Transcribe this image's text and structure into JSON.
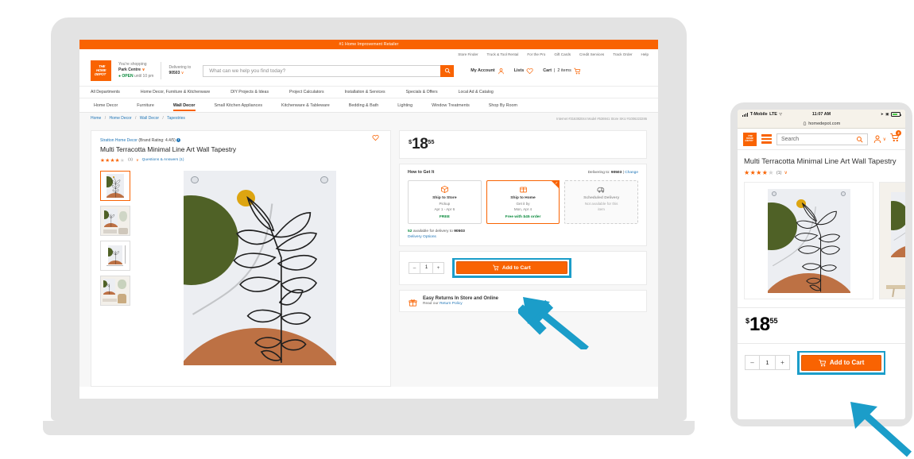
{
  "desktop": {
    "promo_banner": "#1 Home Improvement Retailer",
    "utility_links": [
      "Store Finder",
      "Truck & Tool Rental",
      "For the Pro",
      "Gift Cards",
      "Credit Services",
      "Track Order",
      "Help"
    ],
    "logo_text_1": "THE",
    "logo_text_2": "HOME",
    "logo_text_3": "DEPOT",
    "store": {
      "label": "You're shopping",
      "name": "Park Centre",
      "caret": "∨",
      "status": "OPEN",
      "status_dot": "●",
      "hours": "until 10 pm"
    },
    "delivery": {
      "label": "Delivering to",
      "zip": "90503",
      "caret": "∨"
    },
    "search": {
      "placeholder": "What can we help you find today?",
      "value": ""
    },
    "account": {
      "my_account": "My Account",
      "lists": "Lists",
      "cart_label": "Cart",
      "cart_divider": "|",
      "cart_items": "2 items"
    },
    "dept_nav": [
      "All Departments",
      "Home Decor, Furniture & Kitchenware",
      "DIY Projects & Ideas",
      "Project Calculators",
      "Installation & Services",
      "Specials & Offers",
      "Local Ad & Catalog"
    ],
    "cat_nav": [
      {
        "label": "Home Decor",
        "active": false
      },
      {
        "label": "Furniture",
        "active": false
      },
      {
        "label": "Wall Decor",
        "active": true
      },
      {
        "label": "Small Kitchen Appliances",
        "active": false
      },
      {
        "label": "Kitchenware & Tableware",
        "active": false
      },
      {
        "label": "Bedding & Bath",
        "active": false
      },
      {
        "label": "Lighting",
        "active": false
      },
      {
        "label": "Window Treatments",
        "active": false
      },
      {
        "label": "Shop By Room",
        "active": false
      }
    ],
    "breadcrumb": [
      "Home",
      "Home Decor",
      "Wall Decor",
      "Tapestries"
    ],
    "breadcrumb_sep": "/",
    "ids": "Internet #316382044   Model #536941   Store SKU #1006223286",
    "product": {
      "brand": "Stratton Home Decor",
      "brand_rating": "(Brand Rating: 4.4/5)",
      "info_glyph": "i",
      "title": "Multi Terracotta Minimal Line Art Wall Tapestry",
      "stars_filled": 4,
      "stars_total": 5,
      "review_count": "(1)",
      "rating_caret": "∨",
      "qa_link": "Questions & Answers (1)"
    },
    "price": {
      "currency": "$",
      "dollars": "18",
      "cents": "55"
    },
    "how_to_get_it": {
      "heading": "How to Get It",
      "delivering_label": "Delivering to:",
      "delivering_zip": "90503",
      "divider": "|",
      "change_link": "Change"
    },
    "fulfillment": [
      {
        "name": "Ship to Store",
        "line1": "Pickup",
        "line2": "Apr 1 - Apr 6",
        "badge": "FREE",
        "state": "available",
        "icon": "box-icon"
      },
      {
        "name": "Ship to Home",
        "line1": "Get it by",
        "line2": "Mon, Apr 4",
        "badge": "Free with $45 order",
        "state": "selected",
        "icon": "package-icon",
        "check": "✓"
      },
      {
        "name": "Scheduled Delivery",
        "line1": "Not available for this",
        "line2": "item",
        "badge": "",
        "state": "disabled",
        "icon": "truck-icon"
      }
    ],
    "availability": {
      "count": "52",
      "text": "available for delivery to",
      "zip": "90503",
      "options_link": "Delivery Options"
    },
    "cart": {
      "minus": "–",
      "qty": "1",
      "plus": "+",
      "add_label": "Add to Cart",
      "cart_icon": "cart-icon"
    },
    "returns": {
      "title": "Easy Returns In Store and Online",
      "sub_prefix": "Read our ",
      "policy_link": "Return Policy",
      "icon": "gift-box-icon"
    },
    "wishlist_icon": "heart-icon",
    "gallery": {
      "thumb_count": 4,
      "selected_index": 0
    }
  },
  "mobile": {
    "status_bar": {
      "carrier": "T-Mobile",
      "network": "LTE",
      "wifi": "▽",
      "time": "11:07 AM",
      "location_icon": "➤",
      "rotation_icon": "▣"
    },
    "url": "homedepot.com",
    "lock_icon": "lock-icon",
    "logo_text_1": "THE",
    "logo_text_2": "HOME",
    "logo_text_3": "DEPOT",
    "menu_icon": "hamburger-menu-icon",
    "search": {
      "placeholder": "Search",
      "value": ""
    },
    "account_icon": "person-icon",
    "account_caret": "∨",
    "cart_icon": "cart-icon",
    "cart_badge": "2",
    "title": "Multi Terracotta Minimal Line Art Wall Tapestry",
    "stars_filled": 4,
    "stars_total": 5,
    "review_count": "(1)",
    "rating_caret": "∨",
    "price": {
      "currency": "$",
      "dollars": "18",
      "cents": "55"
    },
    "cart": {
      "minus": "–",
      "qty": "1",
      "plus": "+",
      "add_label": "Add to Cart"
    }
  },
  "annotations": {
    "highlight_color": "#1b9dc9",
    "arrow_color": "#1b9dc9",
    "desktop_arrow_name": "desktop-add-to-cart-pointer",
    "mobile_arrow_name": "mobile-add-to-cart-pointer"
  },
  "colors": {
    "brand_orange": "#f96302",
    "teal_highlight": "#1b9dc9",
    "green_text": "#0a8a3c",
    "link_blue": "#2176b7",
    "device_gray": "#e3e3e3",
    "page_bg": "#f7f7f7",
    "art_olive": "#4f6126",
    "art_terracotta": "#bd7144",
    "art_sun": "#dda511",
    "art_cloth": "#eceef2"
  },
  "stars_glyph": "★"
}
